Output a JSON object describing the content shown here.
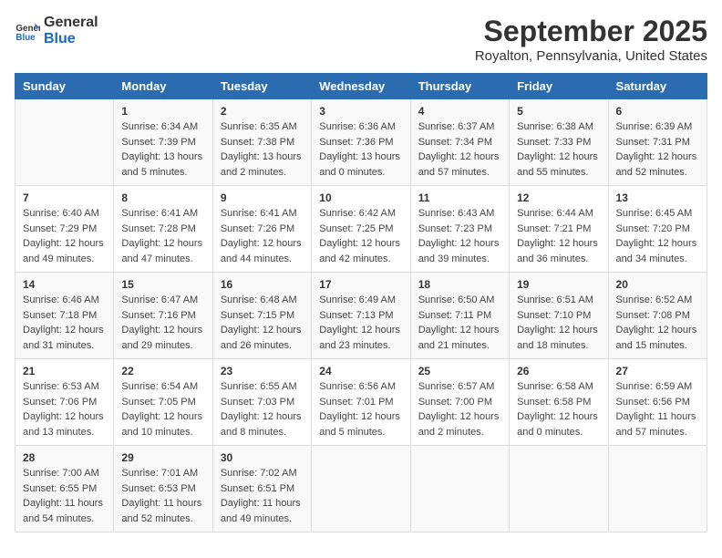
{
  "header": {
    "logo_line1": "General",
    "logo_line2": "Blue",
    "month": "September 2025",
    "location": "Royalton, Pennsylvania, United States"
  },
  "days_of_week": [
    "Sunday",
    "Monday",
    "Tuesday",
    "Wednesday",
    "Thursday",
    "Friday",
    "Saturday"
  ],
  "weeks": [
    [
      {
        "day": "",
        "sunrise": "",
        "sunset": "",
        "daylight": ""
      },
      {
        "day": "1",
        "sunrise": "6:34 AM",
        "sunset": "7:39 PM",
        "daylight": "13 hours and 5 minutes."
      },
      {
        "day": "2",
        "sunrise": "6:35 AM",
        "sunset": "7:38 PM",
        "daylight": "13 hours and 2 minutes."
      },
      {
        "day": "3",
        "sunrise": "6:36 AM",
        "sunset": "7:36 PM",
        "daylight": "13 hours and 0 minutes."
      },
      {
        "day": "4",
        "sunrise": "6:37 AM",
        "sunset": "7:34 PM",
        "daylight": "12 hours and 57 minutes."
      },
      {
        "day": "5",
        "sunrise": "6:38 AM",
        "sunset": "7:33 PM",
        "daylight": "12 hours and 55 minutes."
      },
      {
        "day": "6",
        "sunrise": "6:39 AM",
        "sunset": "7:31 PM",
        "daylight": "12 hours and 52 minutes."
      }
    ],
    [
      {
        "day": "7",
        "sunrise": "6:40 AM",
        "sunset": "7:29 PM",
        "daylight": "12 hours and 49 minutes."
      },
      {
        "day": "8",
        "sunrise": "6:41 AM",
        "sunset": "7:28 PM",
        "daylight": "12 hours and 47 minutes."
      },
      {
        "day": "9",
        "sunrise": "6:41 AM",
        "sunset": "7:26 PM",
        "daylight": "12 hours and 44 minutes."
      },
      {
        "day": "10",
        "sunrise": "6:42 AM",
        "sunset": "7:25 PM",
        "daylight": "12 hours and 42 minutes."
      },
      {
        "day": "11",
        "sunrise": "6:43 AM",
        "sunset": "7:23 PM",
        "daylight": "12 hours and 39 minutes."
      },
      {
        "day": "12",
        "sunrise": "6:44 AM",
        "sunset": "7:21 PM",
        "daylight": "12 hours and 36 minutes."
      },
      {
        "day": "13",
        "sunrise": "6:45 AM",
        "sunset": "7:20 PM",
        "daylight": "12 hours and 34 minutes."
      }
    ],
    [
      {
        "day": "14",
        "sunrise": "6:46 AM",
        "sunset": "7:18 PM",
        "daylight": "12 hours and 31 minutes."
      },
      {
        "day": "15",
        "sunrise": "6:47 AM",
        "sunset": "7:16 PM",
        "daylight": "12 hours and 29 minutes."
      },
      {
        "day": "16",
        "sunrise": "6:48 AM",
        "sunset": "7:15 PM",
        "daylight": "12 hours and 26 minutes."
      },
      {
        "day": "17",
        "sunrise": "6:49 AM",
        "sunset": "7:13 PM",
        "daylight": "12 hours and 23 minutes."
      },
      {
        "day": "18",
        "sunrise": "6:50 AM",
        "sunset": "7:11 PM",
        "daylight": "12 hours and 21 minutes."
      },
      {
        "day": "19",
        "sunrise": "6:51 AM",
        "sunset": "7:10 PM",
        "daylight": "12 hours and 18 minutes."
      },
      {
        "day": "20",
        "sunrise": "6:52 AM",
        "sunset": "7:08 PM",
        "daylight": "12 hours and 15 minutes."
      }
    ],
    [
      {
        "day": "21",
        "sunrise": "6:53 AM",
        "sunset": "7:06 PM",
        "daylight": "12 hours and 13 minutes."
      },
      {
        "day": "22",
        "sunrise": "6:54 AM",
        "sunset": "7:05 PM",
        "daylight": "12 hours and 10 minutes."
      },
      {
        "day": "23",
        "sunrise": "6:55 AM",
        "sunset": "7:03 PM",
        "daylight": "12 hours and 8 minutes."
      },
      {
        "day": "24",
        "sunrise": "6:56 AM",
        "sunset": "7:01 PM",
        "daylight": "12 hours and 5 minutes."
      },
      {
        "day": "25",
        "sunrise": "6:57 AM",
        "sunset": "7:00 PM",
        "daylight": "12 hours and 2 minutes."
      },
      {
        "day": "26",
        "sunrise": "6:58 AM",
        "sunset": "6:58 PM",
        "daylight": "12 hours and 0 minutes."
      },
      {
        "day": "27",
        "sunrise": "6:59 AM",
        "sunset": "6:56 PM",
        "daylight": "11 hours and 57 minutes."
      }
    ],
    [
      {
        "day": "28",
        "sunrise": "7:00 AM",
        "sunset": "6:55 PM",
        "daylight": "11 hours and 54 minutes."
      },
      {
        "day": "29",
        "sunrise": "7:01 AM",
        "sunset": "6:53 PM",
        "daylight": "11 hours and 52 minutes."
      },
      {
        "day": "30",
        "sunrise": "7:02 AM",
        "sunset": "6:51 PM",
        "daylight": "11 hours and 49 minutes."
      },
      {
        "day": "",
        "sunrise": "",
        "sunset": "",
        "daylight": ""
      },
      {
        "day": "",
        "sunrise": "",
        "sunset": "",
        "daylight": ""
      },
      {
        "day": "",
        "sunrise": "",
        "sunset": "",
        "daylight": ""
      },
      {
        "day": "",
        "sunrise": "",
        "sunset": "",
        "daylight": ""
      }
    ]
  ],
  "labels": {
    "sunrise_prefix": "Sunrise: ",
    "sunset_prefix": "Sunset: ",
    "daylight_prefix": "Daylight: "
  }
}
